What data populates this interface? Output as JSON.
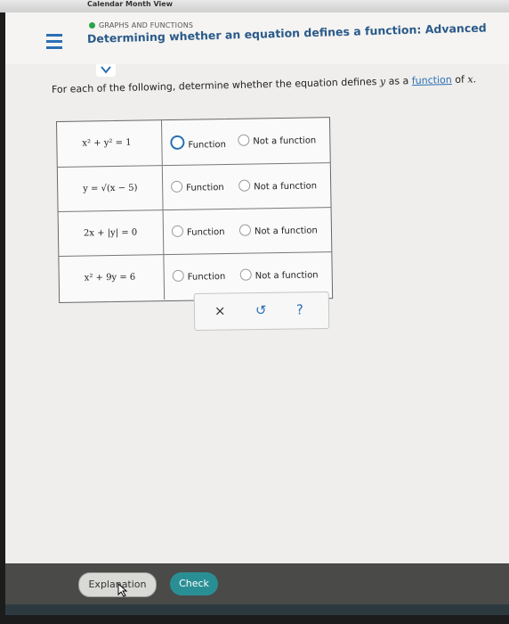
{
  "window": {
    "title": "Calendar Month View"
  },
  "header": {
    "category": "GRAPHS AND FUNCTIONS",
    "title": "Determining whether an equation defines a function: Advanced"
  },
  "prompt": {
    "before": "For each of the following, determine whether the equation defines",
    "y_var": "y",
    "as": "as a",
    "link": "function",
    "of": "of",
    "x_var": "x."
  },
  "rows": [
    {
      "equation": "x² + y² = 1",
      "function_label": "Function",
      "not_function_label": "Not a function",
      "selected": "function"
    },
    {
      "equation": "y = √(x − 5)",
      "function_label": "Function",
      "not_function_label": "Not a function",
      "selected": ""
    },
    {
      "equation": "2x + |y| = 0",
      "function_label": "Function",
      "not_function_label": "Not a function",
      "selected": ""
    },
    {
      "equation": "x² + 9y = 6",
      "function_label": "Function",
      "not_function_label": "Not a function",
      "selected": ""
    }
  ],
  "tools": {
    "clear": "×",
    "undo": "↺",
    "help": "?"
  },
  "footer": {
    "explanation": "Explanation",
    "check": "Check"
  },
  "colors": {
    "accent": "#2a6fb5",
    "check": "#2a8f95",
    "status": "#2aa34a"
  }
}
